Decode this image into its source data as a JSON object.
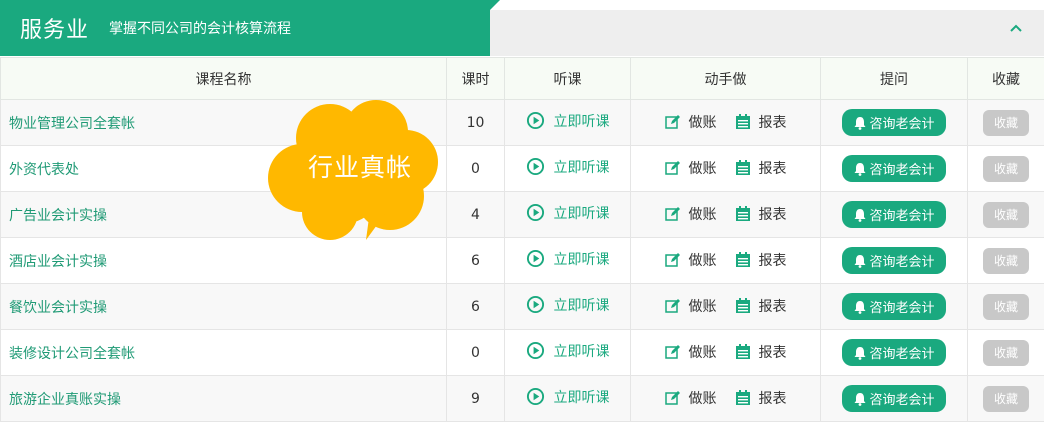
{
  "header": {
    "title": "服务业",
    "subtitle": "掌握不同公司的会计核算流程",
    "collapse_icon": "chevron-up-icon"
  },
  "colors": {
    "accent": "#1aa97f",
    "callout": "#ffb800",
    "favorite_button": "#c8c8c8"
  },
  "table": {
    "columns": [
      "课程名称",
      "课时",
      "听课",
      "动手做",
      "提问",
      "收藏"
    ],
    "rows": [
      {
        "name": "物业管理公司全套帐",
        "hours": "10",
        "listen": "立即听课",
        "do_books": "做账",
        "do_report": "报表",
        "ask": "咨询老会计",
        "fav": "收藏"
      },
      {
        "name": "外资代表处",
        "hours": "0",
        "listen": "立即听课",
        "do_books": "做账",
        "do_report": "报表",
        "ask": "咨询老会计",
        "fav": "收藏"
      },
      {
        "name": "广告业会计实操",
        "hours": "4",
        "listen": "立即听课",
        "do_books": "做账",
        "do_report": "报表",
        "ask": "咨询老会计",
        "fav": "收藏"
      },
      {
        "name": "酒店业会计实操",
        "hours": "6",
        "listen": "立即听课",
        "do_books": "做账",
        "do_report": "报表",
        "ask": "咨询老会计",
        "fav": "收藏"
      },
      {
        "name": "餐饮业会计实操",
        "hours": "6",
        "listen": "立即听课",
        "do_books": "做账",
        "do_report": "报表",
        "ask": "咨询老会计",
        "fav": "收藏"
      },
      {
        "name": "装修设计公司全套帐",
        "hours": "0",
        "listen": "立即听课",
        "do_books": "做账",
        "do_report": "报表",
        "ask": "咨询老会计",
        "fav": "收藏"
      },
      {
        "name": "旅游企业真账实操",
        "hours": "9",
        "listen": "立即听课",
        "do_books": "做账",
        "do_report": "报表",
        "ask": "咨询老会计",
        "fav": "收藏"
      }
    ]
  },
  "callout": {
    "text": "行业真帐"
  }
}
